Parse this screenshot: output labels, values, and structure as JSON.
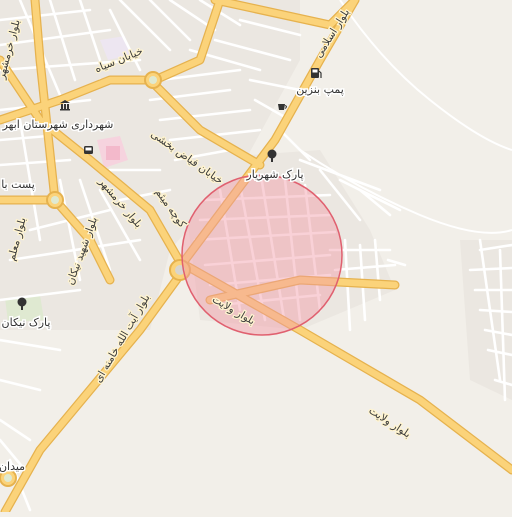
{
  "map": {
    "colors": {
      "background": "#f2efe9",
      "built_area": "#eeebe6",
      "street": "#ffffff",
      "street_edge": "#d6d2ca",
      "major_road": "#fbd37a",
      "major_road_edge": "#e6b24e",
      "hospital_area": "#f6d3de",
      "park_area": "#dfe9d1",
      "highlight_fill": "#f19aa6",
      "highlight_stroke": "#e0606f"
    },
    "labels": {
      "islami": "بلوار اسلامی",
      "pump": "پمپ بنزین",
      "siah": "خیابان سیاه",
      "khorramshahr_top": "بلوار خرمشهر",
      "shahrdari": "شهرداری شهرستان ابهر",
      "fayaz": "خیابان فیاض بخشی",
      "park_shahriar": "پارک شهریار",
      "post": "پست با",
      "khorramshahr_mid": "بلوار خرمشهر",
      "meysam": "کوچه میثم",
      "moali": "بلوار معلم",
      "nikan": "بلوار شهید نیکان",
      "ayatollah": "بلوار آیت الله خامنه ای",
      "velayat_near": "بلوار ولایت",
      "velayat_far": "بلوار ولایت",
      "park_nikan": "پارک نیکان",
      "meydan": "میدان"
    },
    "icons": {
      "fuel": "fuel-pump-icon",
      "cafe": "cafe-icon",
      "building": "government-building-icon",
      "park": "tree-icon",
      "bus": "bus-stop-icon"
    },
    "highlight": {
      "shape": "circle",
      "area": "selected-area"
    }
  }
}
